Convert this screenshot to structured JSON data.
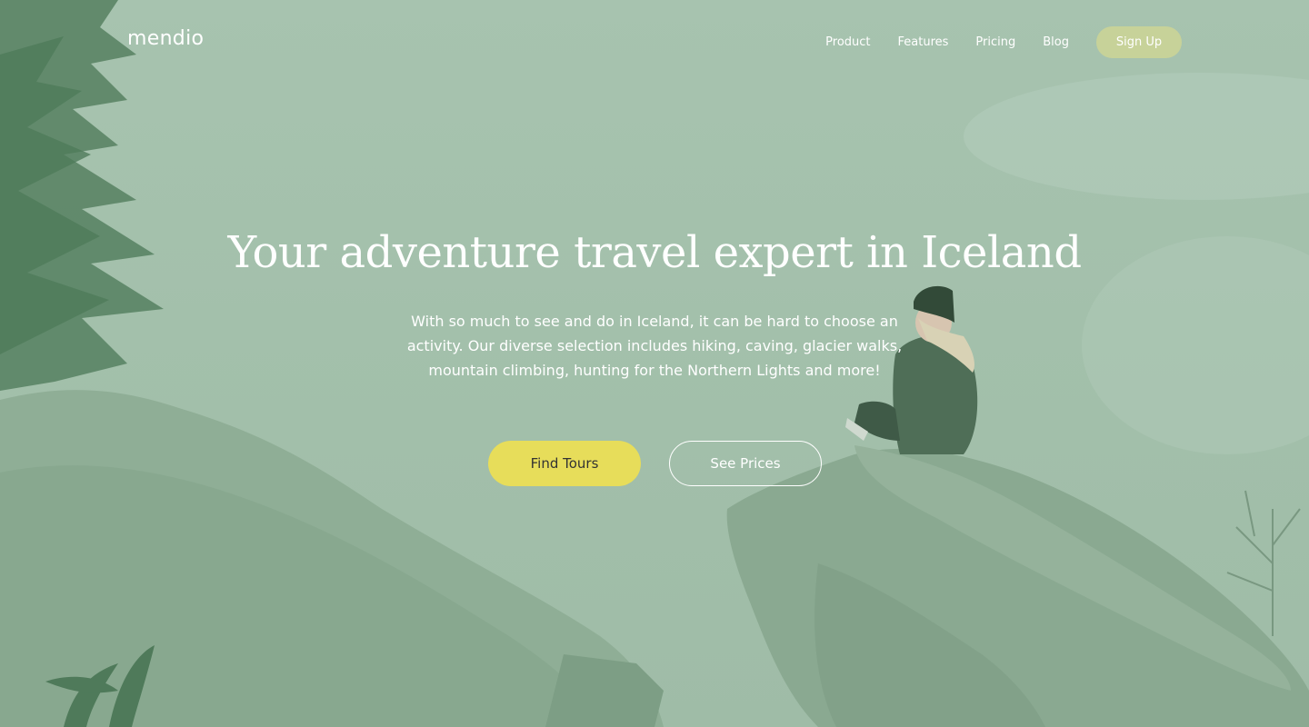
{
  "brand": {
    "logo_text": "mendio"
  },
  "nav": {
    "links": [
      "Product",
      "Features",
      "Pricing",
      "Blog"
    ],
    "signup_label": "Sign Up"
  },
  "hero": {
    "headline": "Your adventure travel expert in Iceland",
    "description": "With so much to see and do in Iceland, it can be hard to choose an activity. Our diverse selection includes hiking, caving, glacier walks, mountain climbing, hunting for the Northern Lights and more!",
    "primary_cta": "Find Tours",
    "secondary_cta": "See Prices"
  },
  "colors": {
    "overlay_tint": "#a5c2ad",
    "primary_button": "#e7dd5a",
    "signup_button": "#c7d299",
    "text": "#ffffff"
  }
}
